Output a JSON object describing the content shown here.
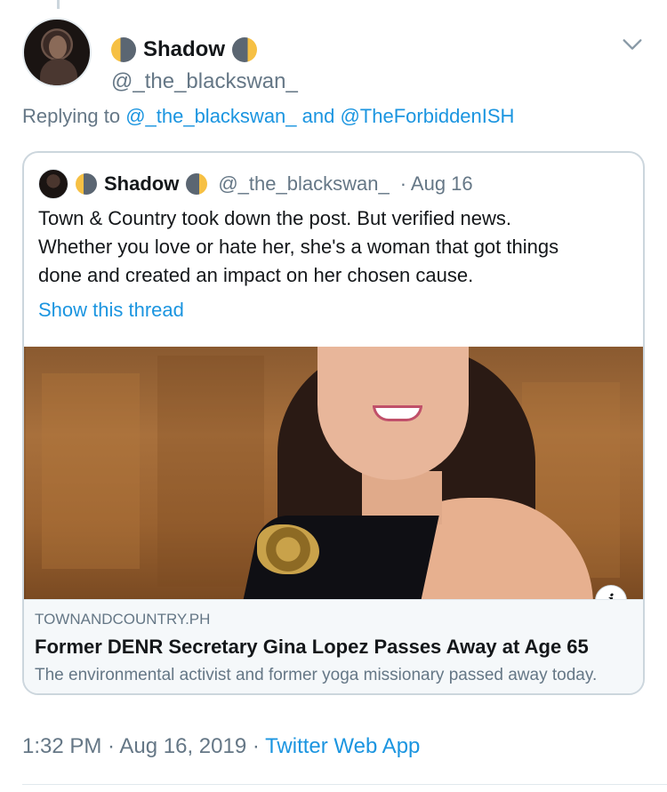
{
  "tweet": {
    "author": {
      "display_name": "Shadow",
      "handle": "@_the_blackswan_",
      "name_icons": [
        "waning-moon-icon",
        "waxing-moon-icon"
      ]
    },
    "replying_prefix": "Replying to ",
    "replying_mentions": [
      "@_the_blackswan_",
      "@TheForbiddenISH"
    ],
    "replying_joiner": " and ",
    "timestamp": "1:32 PM · Aug 16, 2019 · ",
    "source": "Twitter Web App"
  },
  "quoted": {
    "display_name": "Shadow",
    "handle": "@_the_blackswan_",
    "date": "· Aug 16",
    "text_lines": [
      "Town & Country took down the post. But verified news.",
      "Whether you love or hate her, she's a woman that got things",
      "done and created an impact on her chosen cause."
    ],
    "show_thread": "Show this thread",
    "card": {
      "domain": "TOWNANDCOUNTRY.PH",
      "title": "Former DENR Secretary Gina Lopez Passes Away at Age 65",
      "description": "The environmental activist and former yoga missionary passed away today.",
      "info_glyph": "i"
    }
  },
  "colors": {
    "link": "#1b95e0",
    "secondary_text": "#657786",
    "primary_text": "#14171a",
    "border": "#ccd6dd",
    "moon_dark": "#5b6672",
    "moon_light": "#f6c044"
  }
}
